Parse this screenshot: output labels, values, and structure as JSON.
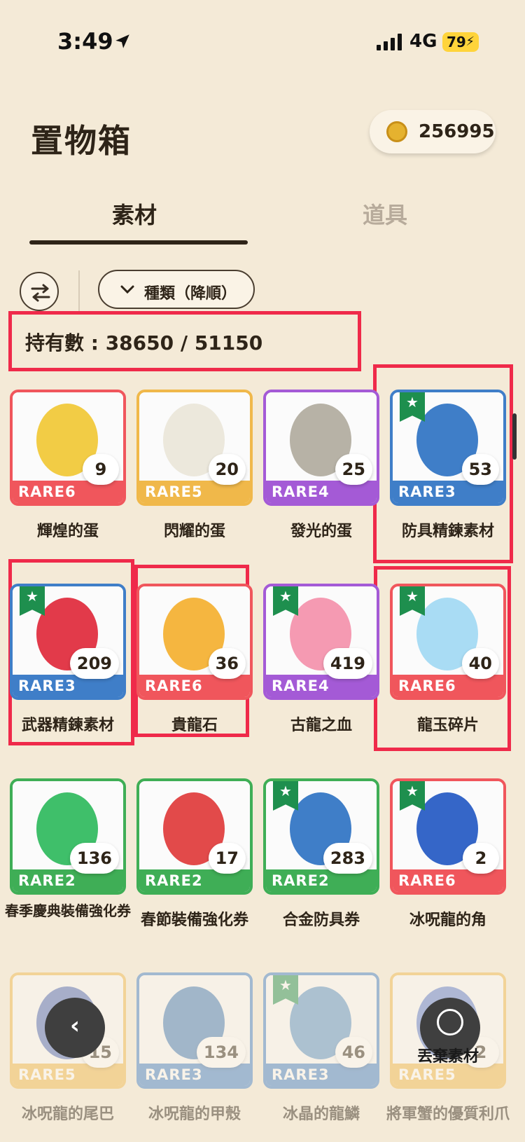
{
  "status_bar": {
    "time": "3:49",
    "network": "4G",
    "battery": "79"
  },
  "header": {
    "title": "置物箱",
    "coins": "256995"
  },
  "tabs": [
    {
      "label": "素材",
      "active": true
    },
    {
      "label": "道具",
      "active": false
    }
  ],
  "filter": {
    "sort_label": "種類（降順）"
  },
  "inventory": {
    "count_text": "持有數 : 38650 / 51150"
  },
  "colors": {
    "rare6": "#f0565c",
    "rare5": "#f0b84a",
    "rare4": "#a45ad6",
    "rare3": "#3f7ec8",
    "rare2": "#3fae56",
    "star": "#1e8f4e",
    "highlight": "#ef2a4a"
  },
  "items": [
    {
      "name": "輝煌的蛋",
      "rarity": "RARE6",
      "qty": "9",
      "star": false,
      "icon": "yellow-egg-icon"
    },
    {
      "name": "閃耀的蛋",
      "rarity": "RARE5",
      "qty": "20",
      "star": false,
      "icon": "white-egg-icon"
    },
    {
      "name": "發光的蛋",
      "rarity": "RARE4",
      "qty": "25",
      "star": false,
      "icon": "grey-egg-icon"
    },
    {
      "name": "防具精鍊素材",
      "rarity": "RARE3",
      "qty": "53",
      "star": true,
      "icon": "blue-bag-icon"
    },
    {
      "name": "武器精鍊素材",
      "rarity": "RARE3",
      "qty": "209",
      "star": true,
      "icon": "red-bag-icon"
    },
    {
      "name": "貴龍石",
      "rarity": "RARE6",
      "qty": "36",
      "star": false,
      "icon": "sun-stone-icon"
    },
    {
      "name": "古龍之血",
      "rarity": "RARE4",
      "qty": "419",
      "star": true,
      "icon": "blood-jar-icon"
    },
    {
      "name": "龍玉碎片",
      "rarity": "RARE6",
      "qty": "40",
      "star": true,
      "icon": "dragon-jade-icon"
    },
    {
      "name": "春季慶典裝備強化券",
      "rarity": "RARE2",
      "qty": "136",
      "star": false,
      "icon": "green-ticket-icon"
    },
    {
      "name": "春節裝備強化券",
      "rarity": "RARE2",
      "qty": "17",
      "star": false,
      "icon": "red-ticket-icon"
    },
    {
      "name": "合金防具券",
      "rarity": "RARE2",
      "qty": "283",
      "star": true,
      "icon": "blue-ticket-icon"
    },
    {
      "name": "冰呪龍的角",
      "rarity": "RARE6",
      "qty": "2",
      "star": true,
      "icon": "ice-horn-icon"
    },
    {
      "name": "冰呪龍的尾巴",
      "rarity": "RARE5",
      "qty": "15",
      "star": false,
      "icon": "ice-tail-icon"
    },
    {
      "name": "冰呪龍的甲殼",
      "rarity": "RARE3",
      "qty": "134",
      "star": false,
      "icon": "ice-shell-icon"
    },
    {
      "name": "冰晶的龍鱗",
      "rarity": "RARE3",
      "qty": "46",
      "star": true,
      "icon": "ice-scale-icon"
    },
    {
      "name": "將軍蟹的優質利爪",
      "rarity": "RARE5",
      "qty": "2",
      "star": false,
      "icon": "crab-claw-icon"
    }
  ],
  "actions": {
    "discard_label": "丟棄素材"
  }
}
